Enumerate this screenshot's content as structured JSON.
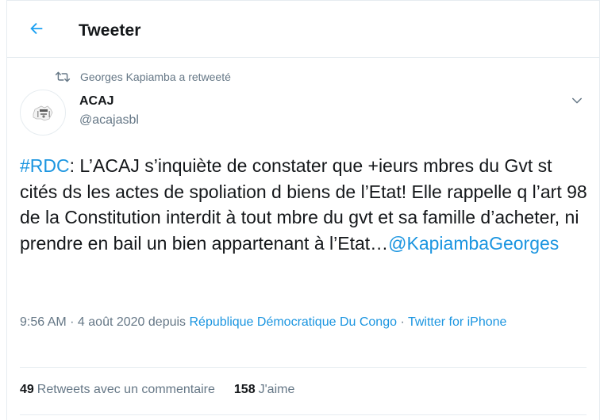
{
  "header": {
    "title": "Tweeter",
    "back_icon": "arrow-left-icon"
  },
  "retweet": {
    "icon": "retweet-icon",
    "text": "Georges Kapiamba a retweeté"
  },
  "author": {
    "name": "ACAJ",
    "handle": "@acajasbl",
    "avatar_icon": "acaj-logo"
  },
  "tweet": {
    "hashtag": "#RDC",
    "body": ": L’ACAJ s’inquiète de constater que +ieurs mbres du Gvt st cités ds les actes de spoliation d biens de l’Etat! Elle rappelle q l’art 98 de la Constitution interdit à tout mbre du gvt et sa famille d’acheter, ni prendre en bail un bien appartenant à l’Etat…",
    "mention": "@KapiambaGeorges"
  },
  "meta": {
    "time": "9:56 AM",
    "sep1": " · ",
    "date": "4 août 2020",
    "via": " depuis ",
    "location": "République Démocratique Du Congo",
    "sep2": " · ",
    "source": "Twitter for iPhone"
  },
  "stats": {
    "retweets_count": "49",
    "retweets_label": "Retweets avec un commentaire",
    "likes_count": "158",
    "likes_label": "J'aime"
  },
  "colors": {
    "accent": "#1b95e0",
    "muted": "#657786",
    "text": "#14171a",
    "border": "#e6ecf0"
  }
}
